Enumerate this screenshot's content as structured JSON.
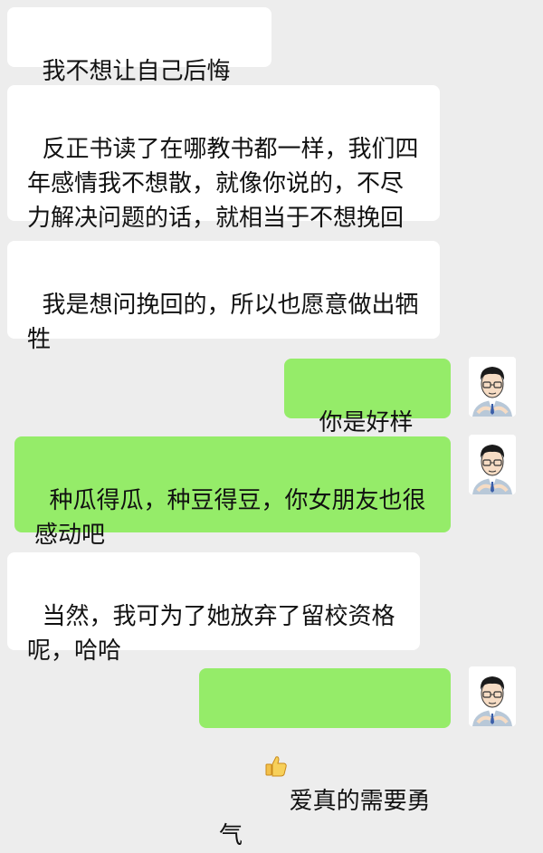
{
  "chat": {
    "messages": [
      {
        "side": "in",
        "text": "我不想让自己后悔吧"
      },
      {
        "side": "in",
        "text": "反正书读了在哪教书都一样，我们四\n年感情我不想散，就像你说的，不尽\n力解决问题的话，就相当于不想挽回"
      },
      {
        "side": "in",
        "text": "我是想问挽回的，所以也愿意做出牺\n牲"
      },
      {
        "side": "out",
        "text": "你是好样的"
      },
      {
        "side": "out",
        "text": "种瓜得瓜，种豆得豆，你女朋友也很\n感动吧"
      },
      {
        "side": "in",
        "text": "当然，我可为了她放弃了留校资格\n呢，哈哈"
      },
      {
        "side": "out",
        "text": "爱真的需要勇气",
        "icon": "thumbs-up-icon"
      }
    ]
  },
  "colors": {
    "background": "#ededed",
    "incoming_bubble": "#ffffff",
    "outgoing_bubble": "#95ec69"
  },
  "icons": {
    "avatar": "cartoon-man-avatar",
    "thumbs_up": "thumbs-up-icon"
  }
}
